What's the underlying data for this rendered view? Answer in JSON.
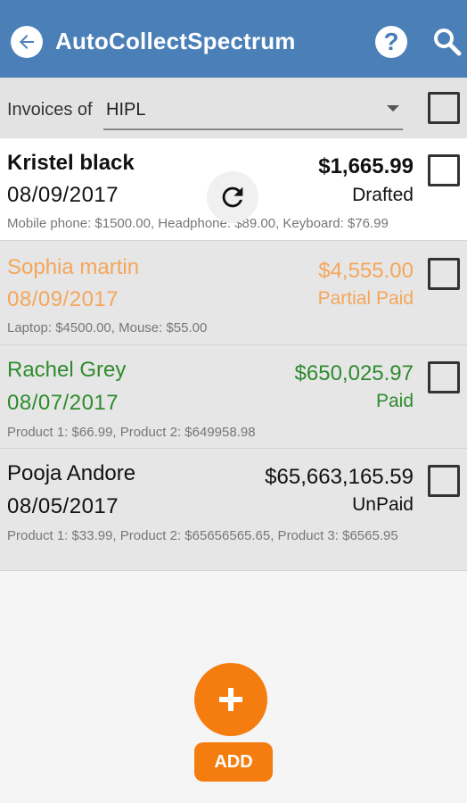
{
  "app": {
    "title": "AutoCollectSpectrum",
    "accent_color": "#4a7fb8",
    "icons": [
      "back-arrow-icon",
      "help-icon",
      "search-icon"
    ]
  },
  "filter": {
    "label": "Invoices of",
    "selected": "HIPL"
  },
  "invoices": [
    {
      "name": "Kristel black",
      "date": "08/09/2017",
      "amount": "$1,665.99",
      "status": "Drafted",
      "items": "Mobile phone: $1500.00, Headphone: $89.00, Keyboard: $76.99",
      "color": "#111111"
    },
    {
      "name": "Sophia martin",
      "date": "08/09/2017",
      "amount": "$4,555.00",
      "status": "Partial Paid",
      "items": "Laptop: $4500.00, Mouse: $55.00",
      "color": "#f5a65b"
    },
    {
      "name": "Rachel Grey",
      "date": "08/07/2017",
      "amount": "$650,025.97",
      "status": "Paid",
      "items": "Product 1: $66.99, Product 2: $649958.98",
      "color": "#2e8b2e"
    },
    {
      "name": "Pooja Andore",
      "date": "08/05/2017",
      "amount": "$65,663,165.59",
      "status": "UnPaid",
      "items": "Product 1: $33.99, Product 2: $65656565.65, Product 3: $6565.95",
      "color": "#111111"
    }
  ],
  "fab": {
    "label": "ADD",
    "color": "#f57d10"
  }
}
